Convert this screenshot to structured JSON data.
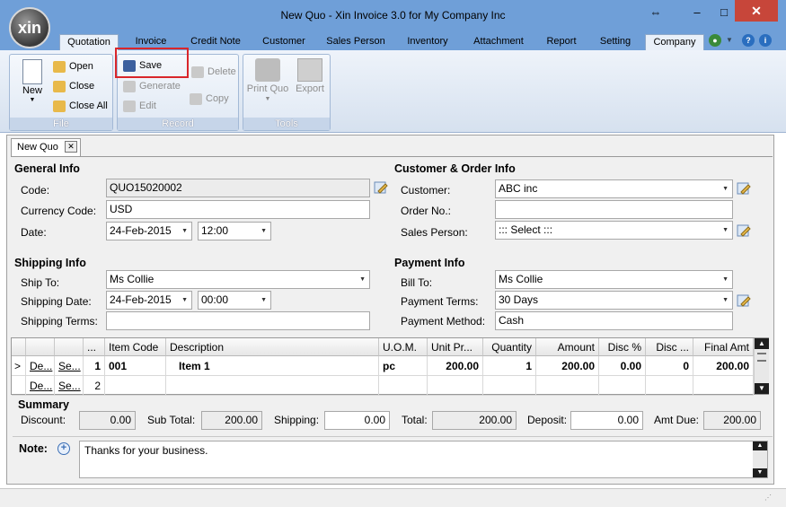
{
  "window": {
    "title": "New Quo - Xin Invoice 3.0 for My Company Inc",
    "logo_text": "xin",
    "restore": "⇔",
    "minimize": "–",
    "maximize": "□",
    "close": "✕"
  },
  "menu_tabs": [
    "Quotation",
    "Invoice",
    "Credit Note",
    "Customer",
    "Sales Person",
    "Inventory",
    "Attachment",
    "Report",
    "Setting",
    "Company"
  ],
  "ribbon": {
    "file": {
      "label": "File",
      "new": "New",
      "open": "Open",
      "close": "Close",
      "close_all": "Close All"
    },
    "record": {
      "label": "Record",
      "save": "Save",
      "delete": "Delete",
      "generate": "Generate",
      "edit": "Edit",
      "copy": "Copy"
    },
    "tools": {
      "label": "Tools",
      "print": "Print Quo",
      "export": "Export"
    }
  },
  "doc_tab": {
    "label": "New Quo",
    "close": "✕"
  },
  "general": {
    "title": "General Info",
    "code_label": "Code:",
    "code_value": "QUO15020002",
    "currency_label": "Currency Code:",
    "currency_value": "USD",
    "date_label": "Date:",
    "date_value": "24-Feb-2015",
    "time_value": "12:00"
  },
  "customer": {
    "title": "Customer & Order Info",
    "customer_label": "Customer:",
    "customer_value": "ABC inc",
    "order_label": "Order No.:",
    "order_value": "",
    "sales_label": "Sales Person:",
    "sales_value": "::: Select :::"
  },
  "shipping": {
    "title": "Shipping Info",
    "ship_to_label": "Ship To:",
    "ship_to_value": "Ms Collie",
    "ship_date_label": "Shipping Date:",
    "ship_date_value": "24-Feb-2015",
    "ship_time_value": "00:00",
    "terms_label": "Shipping Terms:",
    "terms_value": ""
  },
  "payment": {
    "title": "Payment Info",
    "bill_to_label": "Bill To:",
    "bill_to_value": "Ms Collie",
    "terms_label": "Payment Terms:",
    "terms_value": "30 Days",
    "method_label": "Payment Method:",
    "method_value": "Cash"
  },
  "grid": {
    "headers": {
      "dots": "...",
      "item_code": "Item Code",
      "description": "Description",
      "uom": "U.O.M.",
      "unit_price": "Unit Pr...",
      "quantity": "Quantity",
      "amount": "Amount",
      "disc_pct": "Disc %",
      "disc": "Disc ...",
      "final": "Final Amt"
    },
    "rows": [
      {
        "marker": ">",
        "del": "De...",
        "sel": "Se...",
        "no": "1",
        "item_code": "001",
        "description": "Item 1",
        "uom": "pc",
        "unit_price": "200.00",
        "quantity": "1",
        "amount": "200.00",
        "disc_pct": "0.00",
        "disc": "0",
        "final": "200.00"
      },
      {
        "marker": "",
        "del": "De...",
        "sel": "Se...",
        "no": "2",
        "item_code": "",
        "description": "",
        "uom": "",
        "unit_price": "",
        "quantity": "",
        "amount": "",
        "disc_pct": "",
        "disc": "",
        "final": ""
      }
    ]
  },
  "summary": {
    "title": "Summary",
    "discount_label": "Discount:",
    "discount_value": "0.00",
    "subtotal_label": "Sub Total:",
    "subtotal_value": "200.00",
    "shipping_label": "Shipping:",
    "shipping_value": "0.00",
    "total_label": "Total:",
    "total_value": "200.00",
    "deposit_label": "Deposit:",
    "deposit_value": "0.00",
    "amtdue_label": "Amt Due:",
    "amtdue_value": "200.00"
  },
  "note": {
    "label": "Note:",
    "value": "Thanks for your business."
  },
  "colors": {
    "titlebar": "#6f9fd8",
    "close": "#c7463a",
    "highlight": "#d9262b"
  }
}
